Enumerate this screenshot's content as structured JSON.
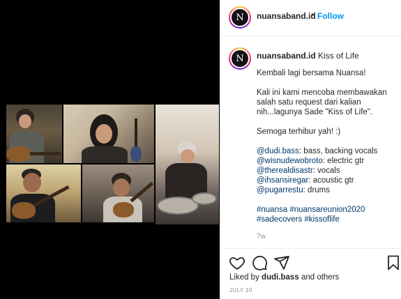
{
  "post": {
    "username": "nuansaband.id",
    "avatar_letter": "N",
    "dot": "•",
    "follow_label": "Follow"
  },
  "caption": {
    "username": "nuansaband.id",
    "title": "Kiss of Life",
    "lines": [
      "Kembali lagi bersama Nuansa!",
      "Kali ini kami mencoba membawakan",
      "salah satu request dari kalian",
      "nih...lagunya Sade \"Kiss of Life\".",
      "Semoga terhibur yah! :)"
    ],
    "credits": [
      {
        "handle": "@dudi.bass",
        "role": ": bass, backing vocals"
      },
      {
        "handle": "@wisnudewobroto",
        "role": ": electric gtr"
      },
      {
        "handle": "@therealdisastr",
        "role": ": vocals"
      },
      {
        "handle": "@ihsansiregar",
        "role": ": acoustic gtr"
      },
      {
        "handle": "@pugarrestu",
        "role": ": drums"
      }
    ],
    "hashtags_line1": "#nuansa #nuansareunion2020",
    "hashtags_line2": "#sadecovers #kissoflife",
    "age": "7w"
  },
  "actions": {
    "like_icon": "heart-icon",
    "comment_icon": "comment-icon",
    "share_icon": "share-icon",
    "save_icon": "bookmark-icon"
  },
  "likes": {
    "prefix": "Liked by",
    "user": "dudi.bass",
    "suffix": "and others"
  },
  "date": "JULY 10"
}
